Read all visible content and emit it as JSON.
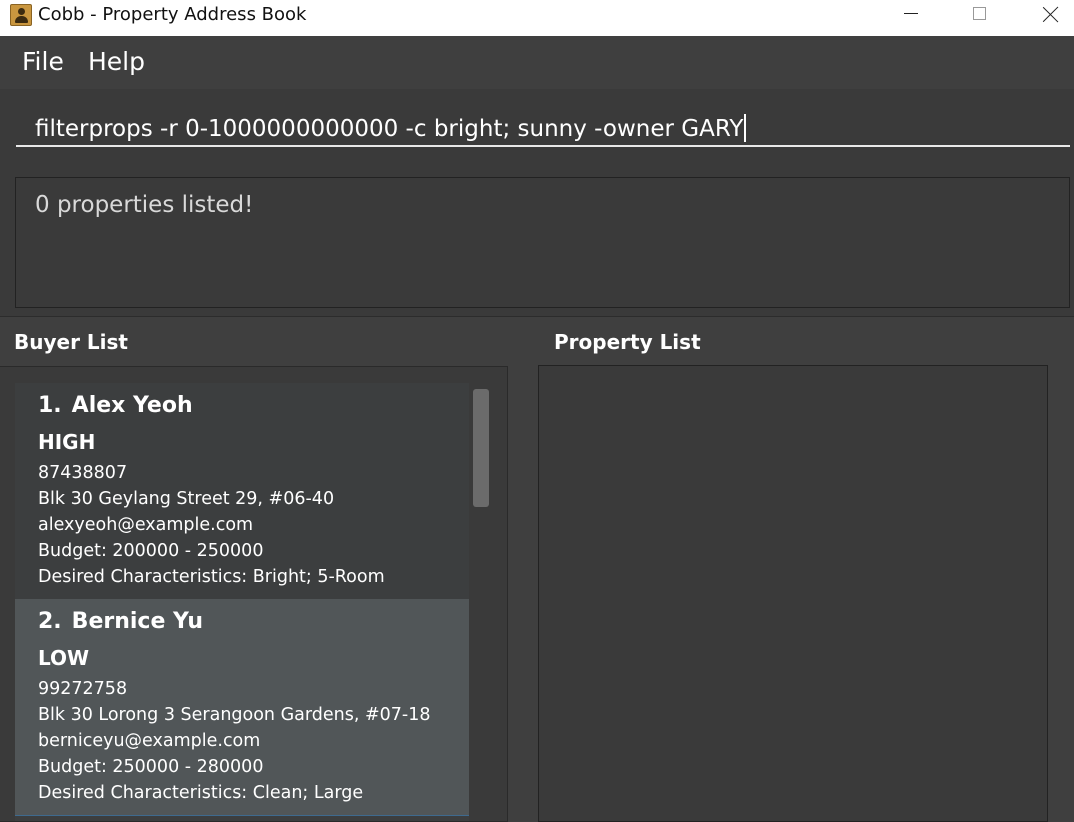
{
  "window": {
    "title": "Cobb - Property Address Book"
  },
  "menu": {
    "file_label": "File",
    "help_label": "Help"
  },
  "command": {
    "value": "filterprops -r 0-1000000000000 -c bright; sunny -owner GARY"
  },
  "result": {
    "message": "0 properties listed!"
  },
  "buyer_panel": {
    "title": "Buyer List",
    "buyers": [
      {
        "index": "1.",
        "name": "Alex Yeoh",
        "priority": "HIGH",
        "phone": "87438807",
        "address": "Blk 30 Geylang Street 29, #06-40",
        "email": "alexyeoh@example.com",
        "budget": "Budget: 200000 - 250000",
        "desired": "Desired Characteristics: Bright; 5-Room"
      },
      {
        "index": "2.",
        "name": "Bernice Yu",
        "priority": "LOW",
        "phone": "99272758",
        "address": "Blk 30 Lorong 3 Serangoon Gardens, #07-18",
        "email": "berniceyu@example.com",
        "budget": "Budget: 250000 - 280000",
        "desired": "Desired Characteristics: Clean; Large"
      }
    ]
  },
  "property_panel": {
    "title": "Property List"
  },
  "colors": {
    "background": "#3f3f3f",
    "card": "#3c3e3f",
    "card_selected": "#515658"
  }
}
